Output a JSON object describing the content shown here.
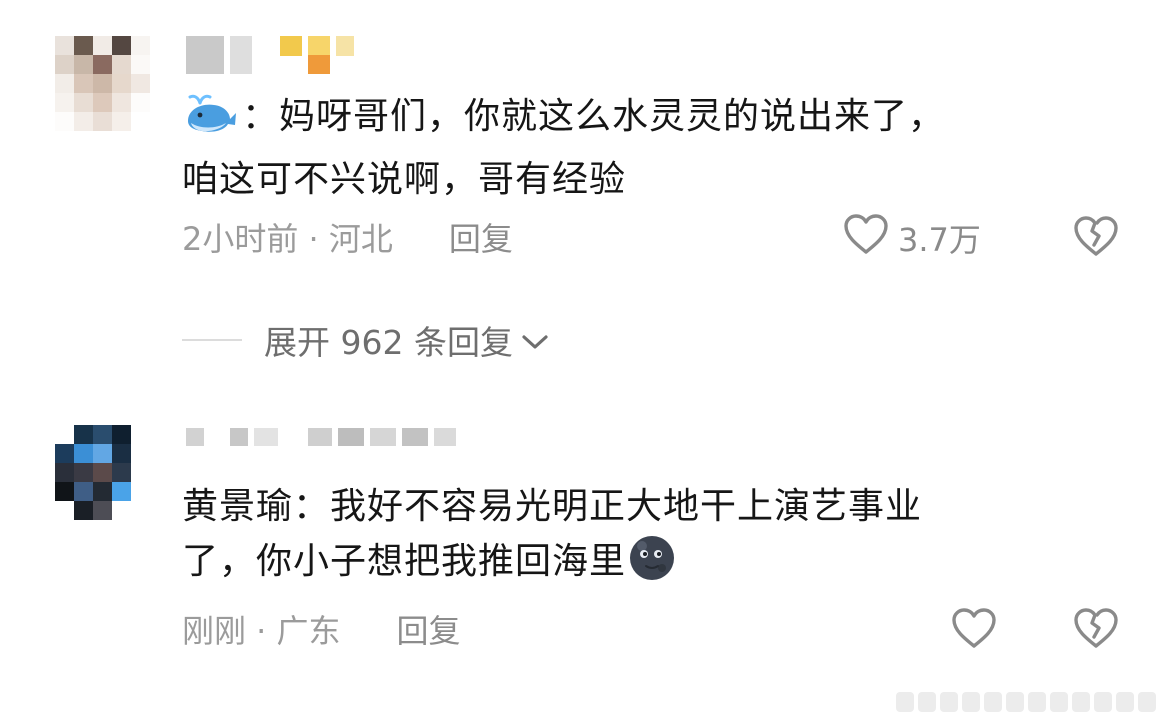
{
  "comments": [
    {
      "text_line1": "：妈呀哥们，你就这么水灵灵的说出来了，",
      "text_line2": "咱这可不兴说啊，哥有经验",
      "emoji_icon": "whale-icon",
      "time_location": "2小时前 · 河北",
      "reply_label": "回复",
      "like_count": "3.7万"
    },
    {
      "text_line1": "黄景瑜：我好不容易光明正大地干上演艺事业",
      "text_line2": "了，你小子想把我推回海里",
      "emoji_icon": "new-moon-face-icon",
      "time_location": "刚刚 · 广东",
      "reply_label": "回复",
      "like_count": ""
    }
  ],
  "expand_replies": {
    "label": "展开 962 条回复"
  },
  "colors": {
    "text": "#161616",
    "meta": "#9b9b9b",
    "icon": "#8a8a8a"
  }
}
